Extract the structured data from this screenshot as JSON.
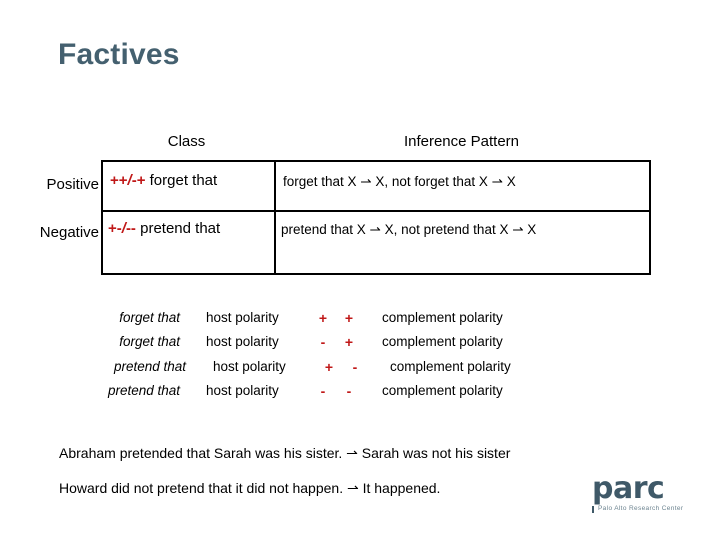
{
  "slide": {
    "title": "Factives"
  },
  "table": {
    "headers": {
      "class": "Class",
      "inference": "Inference Pattern"
    },
    "row_labels": {
      "positive": "Positive",
      "negative": "Negative"
    },
    "rows": [
      {
        "label": "Positive",
        "signature": "++/-+",
        "predicate": "forget that",
        "inference": "forget that X ⇀ X, not forget that X ⇀ X"
      },
      {
        "label": "Negative",
        "signature": "+-/--",
        "predicate": "pretend that",
        "inference": "pretend that X ⇀ X, not pretend that X ⇀ X"
      }
    ]
  },
  "polarity_table": {
    "rows": [
      {
        "predicate": "forget that",
        "host": "host polarity",
        "sign_a": "+",
        "sign_b": "+",
        "complement": "complement polarity"
      },
      {
        "predicate": "forget that",
        "host": "host polarity",
        "sign_a": "-",
        "sign_b": "+",
        "complement": "complement polarity"
      },
      {
        "predicate": "pretend that",
        "host": "host polarity",
        "sign_a": "+",
        "sign_b": "-",
        "complement": "complement polarity"
      },
      {
        "predicate": "pretend that",
        "host": "host polarity",
        "sign_a": "-",
        "sign_b": "-",
        "complement": "complement polarity"
      }
    ]
  },
  "examples": [
    "Abraham pretended that Sarah was his sister. ⇀ Sarah was not his sister",
    "Howard did not pretend that it did not happen. ⇀ It happened."
  ],
  "logo": {
    "word": "parc",
    "subtitle": "Palo Alto Research Center"
  },
  "colors": {
    "title": "#44606f",
    "accent_red": "#c01818",
    "logo": "#3f5968"
  }
}
